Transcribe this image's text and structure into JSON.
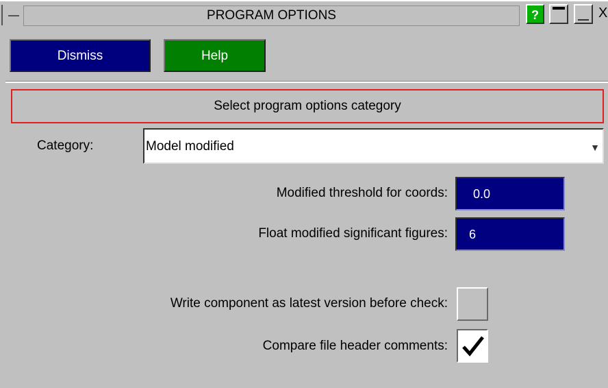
{
  "window": {
    "title": "PROGRAM OPTIONS",
    "help_glyph": "?",
    "close_glyph": "X"
  },
  "toolbar": {
    "dismiss_label": "Dismiss",
    "help_label": "Help"
  },
  "banner": {
    "text": "Select program options category"
  },
  "category": {
    "label": "Category:",
    "selected": "Model modified",
    "arrow_glyph": "▼"
  },
  "options": {
    "coord_threshold": {
      "label": "Modified threshold for coords:",
      "value": "0.0"
    },
    "sig_figs": {
      "label": "Float modified significant figures:",
      "value": "6"
    },
    "write_latest": {
      "label": "Write component as latest version before check:",
      "checked": false
    },
    "compare_header": {
      "label": "Compare file header comments:",
      "checked": true
    }
  },
  "colors": {
    "background": "#c0c0c0",
    "dismiss_button": "#00007f",
    "help_button": "#007f00",
    "field_bg": "#000080",
    "banner_border": "#e02020",
    "help_q": "#07b007"
  }
}
